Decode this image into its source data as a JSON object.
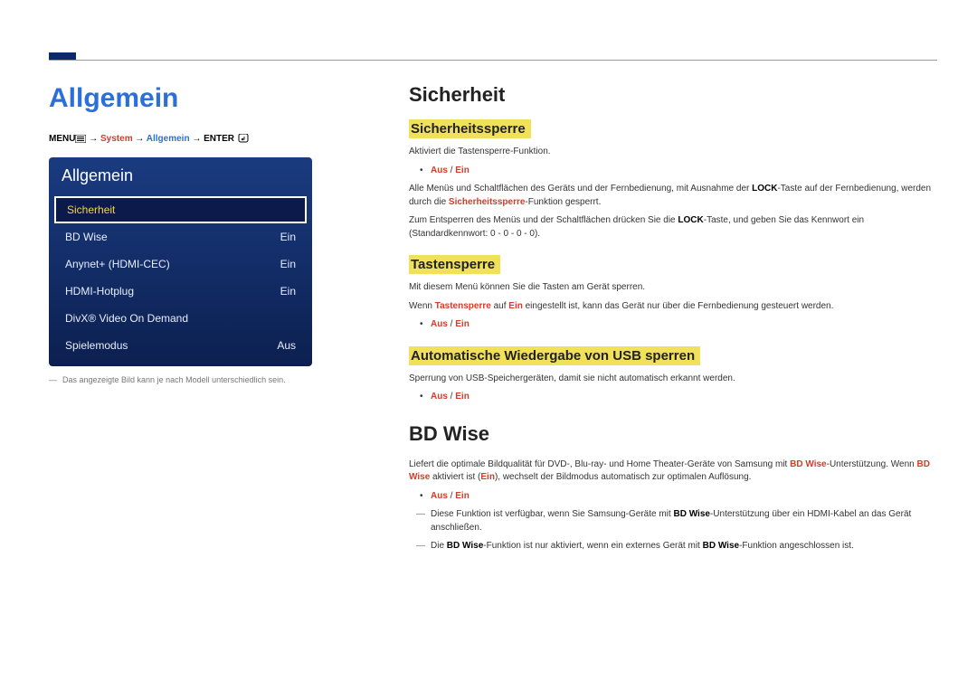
{
  "page_title": "Allgemein",
  "breadcrumb": {
    "p1": "MENU",
    "arrow": " → ",
    "p2": "System",
    "p3": "Allgemein",
    "p4": "ENTER"
  },
  "menu_panel": {
    "header": "Allgemein",
    "items": [
      {
        "label": "Sicherheit",
        "value": "",
        "selected": true
      },
      {
        "label": "BD Wise",
        "value": "Ein",
        "selected": false
      },
      {
        "label": "Anynet+ (HDMI-CEC)",
        "value": "Ein",
        "selected": false
      },
      {
        "label": "HDMI-Hotplug",
        "value": "Ein",
        "selected": false
      },
      {
        "label": "DivX® Video On Demand",
        "value": "",
        "selected": false
      },
      {
        "label": "Spielemodus",
        "value": "Aus",
        "selected": false
      }
    ]
  },
  "left_footnote": "Das angezeigte Bild kann je nach Modell unterschiedlich sein.",
  "r": {
    "h_sicherheit": "Sicherheit",
    "h_ssperre": "Sicherheitssperre",
    "ssperre_p1": "Aktiviert die Tastensperre-Funktion.",
    "aus_ein": "Aus",
    "slash": " / ",
    "ein": "Ein",
    "ssperre_p2a": "Alle Menüs und Schaltflächen des Geräts und der Fernbedienung, mit Ausnahme der ",
    "lock": "LOCK",
    "ssperre_p2b": "-Taste auf der Fernbedienung, werden durch die ",
    "ssperre_fn": "Sicherheitssperre",
    "ssperre_p2c": "-Funktion gesperrt.",
    "ssperre_p3a": "Zum Entsperren des Menüs und der Schaltflächen drücken Sie die ",
    "ssperre_p3b": "-Taste, und geben Sie das Kennwort ein (Standardkennwort: 0 - 0 - 0 - 0).",
    "h_tsperre": "Tastensperre",
    "tsperre_p1": "Mit diesem Menü können Sie die Tasten am Gerät sperren.",
    "tsperre_p2a": "Wenn ",
    "tsperre_fn": "Tastensperre",
    "tsperre_p2b": " auf ",
    "tsperre_ein": "Ein",
    "tsperre_p2c": " eingestellt ist, kann das Gerät nur über die Fernbedienung gesteuert werden.",
    "h_usb": "Automatische Wiedergabe von USB sperren",
    "usb_p1": "Sperrung von USB-Speichergeräten, damit sie nicht automatisch erkannt werden.",
    "h_bdwise": "BD Wise",
    "bd_p1a": "Liefert die optimale Bildqualität für DVD-, Blu-ray- und Home Theater-Geräte von Samsung mit ",
    "bdwise": "BD Wise",
    "bd_p1b": "-Unterstützung. Wenn ",
    "bd_p1c": " aktiviert ist (",
    "bd_p1d": "), wechselt der Bildmodus automatisch zur optimalen Auflösung.",
    "bd_note1a": "Diese Funktion ist verfügbar, wenn Sie Samsung-Geräte mit ",
    "bd_note1b": "-Unterstützung über ein HDMI-Kabel an das Gerät anschließen.",
    "bd_note2a": "Die ",
    "bd_note2b": "-Funktion ist nur aktiviert, wenn ein externes Gerät mit ",
    "bd_note2c": "-Funktion angeschlossen ist."
  }
}
